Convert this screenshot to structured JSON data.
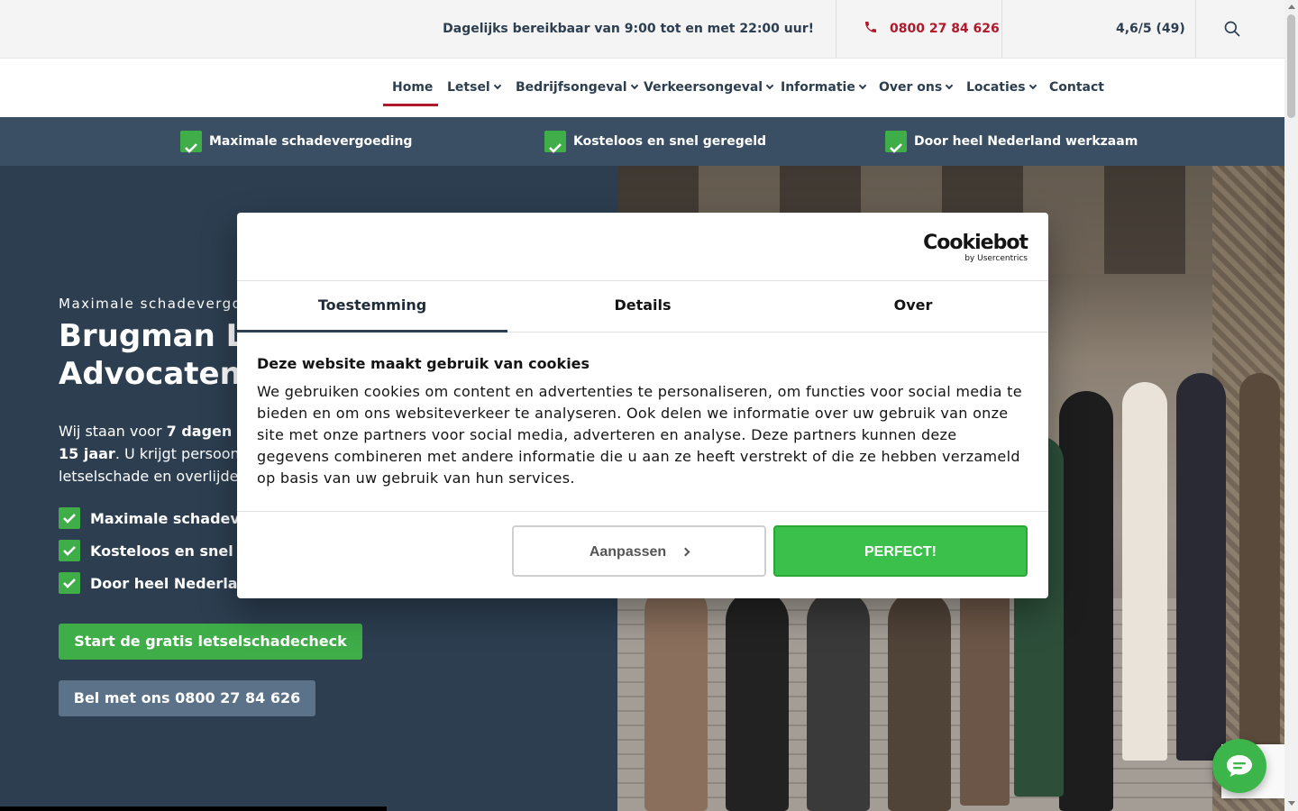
{
  "topbar": {
    "hours": "Dagelijks bereikbaar van 9:00 tot en met 22:00 uur!",
    "phone": "0800 27 84 626",
    "rating": "4,6/5 (49)",
    "search_icon": "search-icon"
  },
  "nav": {
    "items": [
      {
        "label": "Home",
        "dropdown": false,
        "active": true
      },
      {
        "label": "Letsel",
        "dropdown": true
      },
      {
        "label": "Bedrijfsongeval",
        "dropdown": true
      },
      {
        "label": "Verkeersongeval",
        "dropdown": true
      },
      {
        "label": "Informatie",
        "dropdown": true
      },
      {
        "label": "Over ons",
        "dropdown": true
      },
      {
        "label": "Locaties",
        "dropdown": true
      },
      {
        "label": "Contact",
        "dropdown": false
      }
    ]
  },
  "usp": [
    "Maximale schadevergoeding",
    "Kosteloos en snel geregeld",
    "Door heel Nederland werkzaam"
  ],
  "hero": {
    "eyebrow": "Maximale schadevergoed",
    "title_line1": "Brugman Let",
    "title_line2": "Advocaten",
    "lead_p1": "Wij staan voor ",
    "lead_b1": "7 dagen per",
    "lead_b2": "15 jaar",
    "lead_p2": ". U krijgt persoonlijk",
    "lead_p3": "letselschade en overlijdens",
    "checks": [
      "Maximale schadever",
      "Kosteloos en snel ge",
      "Door heel Nederland"
    ],
    "cta_primary": "Start de gratis letselschadecheck",
    "cta_secondary": "Bel met ons 0800 27 84 626"
  },
  "cookie": {
    "logo_main": "Cookiebot",
    "logo_sub": "by Usercentrics",
    "tabs": [
      "Toestemming",
      "Details",
      "Over"
    ],
    "active_tab": "Toestemming",
    "title": "Deze website maakt gebruik van cookies",
    "body": "We gebruiken cookies om content en advertenties te personaliseren, om functies voor social media te bieden en om ons websiteverkeer te analyseren. Ook delen we informatie over uw gebruik van onze site met onze partners voor social media, adverteren en analyse. Deze partners kunnen deze gegevens combineren met andere informatie die u aan ze heeft verstrekt of die ze hebben verzameld op basis van uw gebruik van hun services.",
    "btn_adjust": "Aanpassen",
    "btn_accept": "PERFECT!"
  },
  "colors": {
    "brand_dark": "#2c3e50",
    "brand_red": "#b0182b",
    "green": "#3fae49",
    "usp_band": "#3a4f63"
  }
}
